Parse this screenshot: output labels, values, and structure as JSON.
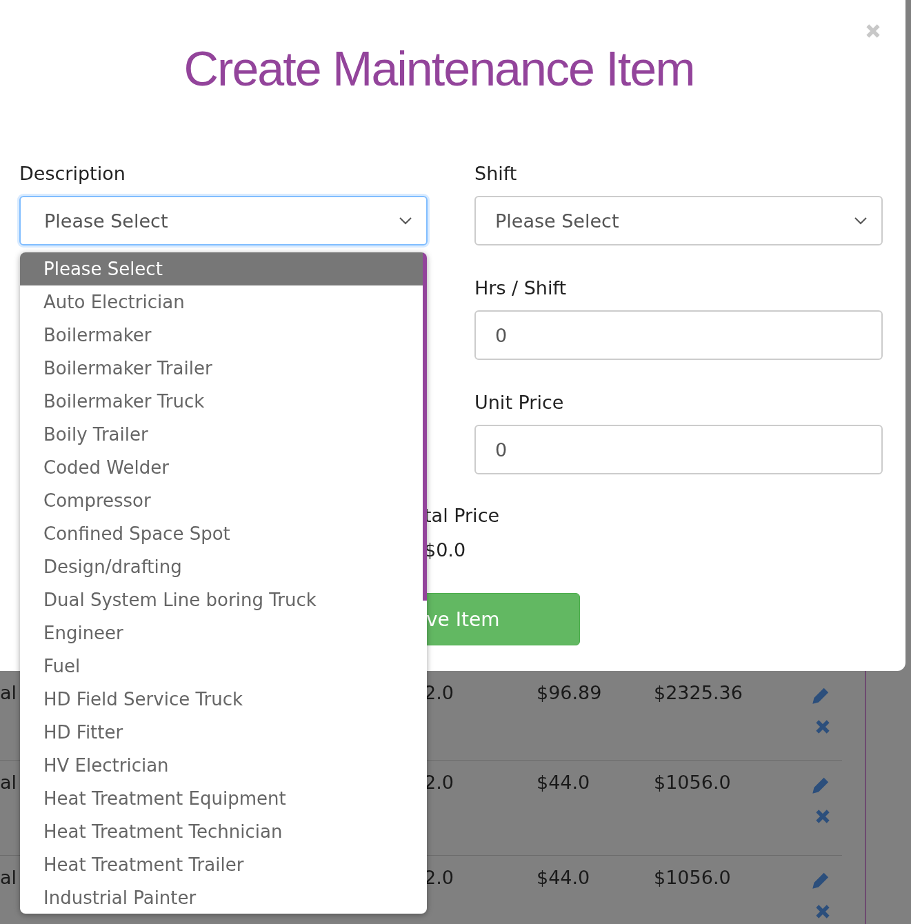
{
  "dialog": {
    "title": "Create Maintenance Item"
  },
  "description": {
    "label": "Description",
    "value": "Please Select"
  },
  "shift": {
    "label": "Shift",
    "value": "Please Select"
  },
  "hrs_per_shift": {
    "label": "Hrs / Shift",
    "value": "0"
  },
  "unit_price": {
    "label": "Unit Price",
    "value": "0"
  },
  "total_price": {
    "label": "tal Price",
    "value": "$0.0"
  },
  "save_button": "ve Item",
  "description_options": [
    {
      "label": "Please Select",
      "selected": true
    },
    {
      "label": "Auto Electrician",
      "selected": false
    },
    {
      "label": "Boilermaker",
      "selected": false
    },
    {
      "label": "Boilermaker Trailer",
      "selected": false
    },
    {
      "label": "Boilermaker Truck",
      "selected": false
    },
    {
      "label": "Boily Trailer",
      "selected": false
    },
    {
      "label": "Coded Welder",
      "selected": false
    },
    {
      "label": "Compressor",
      "selected": false
    },
    {
      "label": "Confined Space Spot",
      "selected": false
    },
    {
      "label": "Design/drafting",
      "selected": false
    },
    {
      "label": "Dual System Line boring Truck",
      "selected": false
    },
    {
      "label": "Engineer",
      "selected": false
    },
    {
      "label": "Fuel",
      "selected": false
    },
    {
      "label": "HD Field Service Truck",
      "selected": false
    },
    {
      "label": "HD Fitter",
      "selected": false
    },
    {
      "label": "HV Electrician",
      "selected": false
    },
    {
      "label": "Heat Treatment Equipment",
      "selected": false
    },
    {
      "label": "Heat Treatment Technician",
      "selected": false
    },
    {
      "label": "Heat Treatment Trailer",
      "selected": false
    },
    {
      "label": "Industrial Painter",
      "selected": false
    }
  ],
  "background_table": {
    "rows": [
      {
        "column_1": "al",
        "column_2": "2.0",
        "column_3": "$96.89",
        "column_4": "$2325.36"
      },
      {
        "column_1": "al",
        "column_2": "2.0",
        "column_3": "$44.0",
        "column_4": "$1056.0"
      },
      {
        "column_1": "al",
        "column_2": "2.0",
        "column_3": "$44.0",
        "column_4": "$1056.0"
      }
    ]
  }
}
